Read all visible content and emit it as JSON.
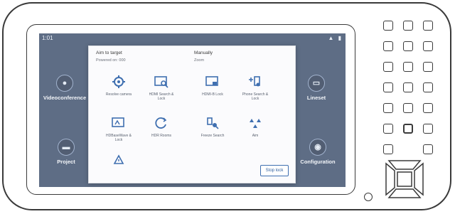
{
  "statusbar": {
    "time": "1:01",
    "icons": "▲ ▮"
  },
  "home_tiles": [
    {
      "label": "Videoconference",
      "icon": "camera-icon"
    },
    {
      "label": "Project",
      "icon": "projector-icon"
    },
    {
      "label": "Lineset",
      "icon": "screen-icon"
    },
    {
      "label": "Configuration",
      "icon": "settings-icon"
    }
  ],
  "dialog": {
    "left_section": {
      "title": "Aim to target",
      "subtitle": "Powered on: 000"
    },
    "right_section": {
      "title": "Manually",
      "subtitle": "Zoom"
    },
    "items": [
      {
        "label": "Resolve camera",
        "icon": "gear-icon"
      },
      {
        "label": "HDMI Search & Lock",
        "icon": "search-screen-icon"
      },
      {
        "label": "HDMI-B Lock",
        "icon": "screen-lock-icon"
      },
      {
        "label": "Phone Search & Lock",
        "icon": "phone-search-icon"
      },
      {
        "label": "HDBaseWave & Lock",
        "icon": "display-lock-icon"
      },
      {
        "label": "HDR Rooms",
        "icon": "rotate-icon"
      },
      {
        "label": "Freeze Search",
        "icon": "freeze-search-icon"
      },
      {
        "label": "Aim",
        "icon": "triangles-icon"
      },
      {
        "label": "",
        "icon": "warning-icon"
      }
    ],
    "stop_button": "Stop lock"
  },
  "colors": {
    "screen_bg": "#3b4d6b",
    "accent": "#3f6fb0"
  }
}
